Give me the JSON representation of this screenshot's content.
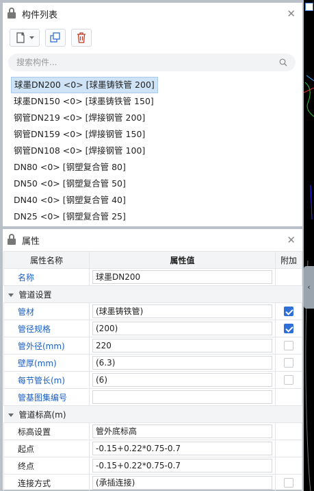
{
  "component_panel": {
    "title": "构件列表",
    "search_placeholder": "搜索构件...",
    "items": [
      "球墨DN200 <0> [球墨铸铁管 200]",
      "球墨DN150 <0> [球墨铸铁管 150]",
      "钢管DN219 <0> [焊接钢管 200]",
      "钢管DN159 <0> [焊接钢管 150]",
      "钢管DN108 <0> [焊接钢管 100]",
      "DN80 <0> [钢塑复合管 80]",
      "DN50 <0> [钢塑复合管 50]",
      "DN40 <0> [钢塑复合管 40]",
      "DN25 <0> [钢塑复合管 25]"
    ],
    "selected_index": 0
  },
  "property_panel": {
    "title": "属性",
    "headers": {
      "name": "属性名称",
      "value": "属性值",
      "add": "附加"
    },
    "rows": [
      {
        "kind": "row",
        "name": "名称",
        "value": "球墨DN200",
        "blue": true,
        "check": null
      },
      {
        "kind": "group",
        "name": "管道设置"
      },
      {
        "kind": "row",
        "name": "管材",
        "value": "(球墨铸铁管)",
        "blue": true,
        "check": true
      },
      {
        "kind": "row",
        "name": "管径规格",
        "value": "(200)",
        "blue": true,
        "check": true
      },
      {
        "kind": "row",
        "name": "管外径(mm)",
        "value": "220",
        "blue": true,
        "check": false
      },
      {
        "kind": "row",
        "name": "壁厚(mm)",
        "value": "(6.3)",
        "blue": true,
        "check": false
      },
      {
        "kind": "row",
        "name": "每节管长(m)",
        "value": "(6)",
        "blue": true,
        "check": false
      },
      {
        "kind": "row",
        "name": "管基图集编号",
        "value": "",
        "blue": true,
        "check": null
      },
      {
        "kind": "group",
        "name": "管道标高(m)"
      },
      {
        "kind": "row",
        "name": "标高设置",
        "value": "管外底标高",
        "blue": false,
        "check": null
      },
      {
        "kind": "row",
        "name": "起点",
        "value": "-0.15+0.22*0.75-0.7",
        "blue": false,
        "check": null
      },
      {
        "kind": "row",
        "name": "终点",
        "value": "-0.15+0.22*0.75-0.7",
        "blue": false,
        "check": null
      },
      {
        "kind": "row",
        "name": "连接方式",
        "value": "(承插连接)",
        "blue": false,
        "check": false
      }
    ]
  },
  "colors": {
    "accent": "#2f6fd6",
    "blue_text": "#1a5fc4",
    "selection": "#cfe3f7"
  }
}
